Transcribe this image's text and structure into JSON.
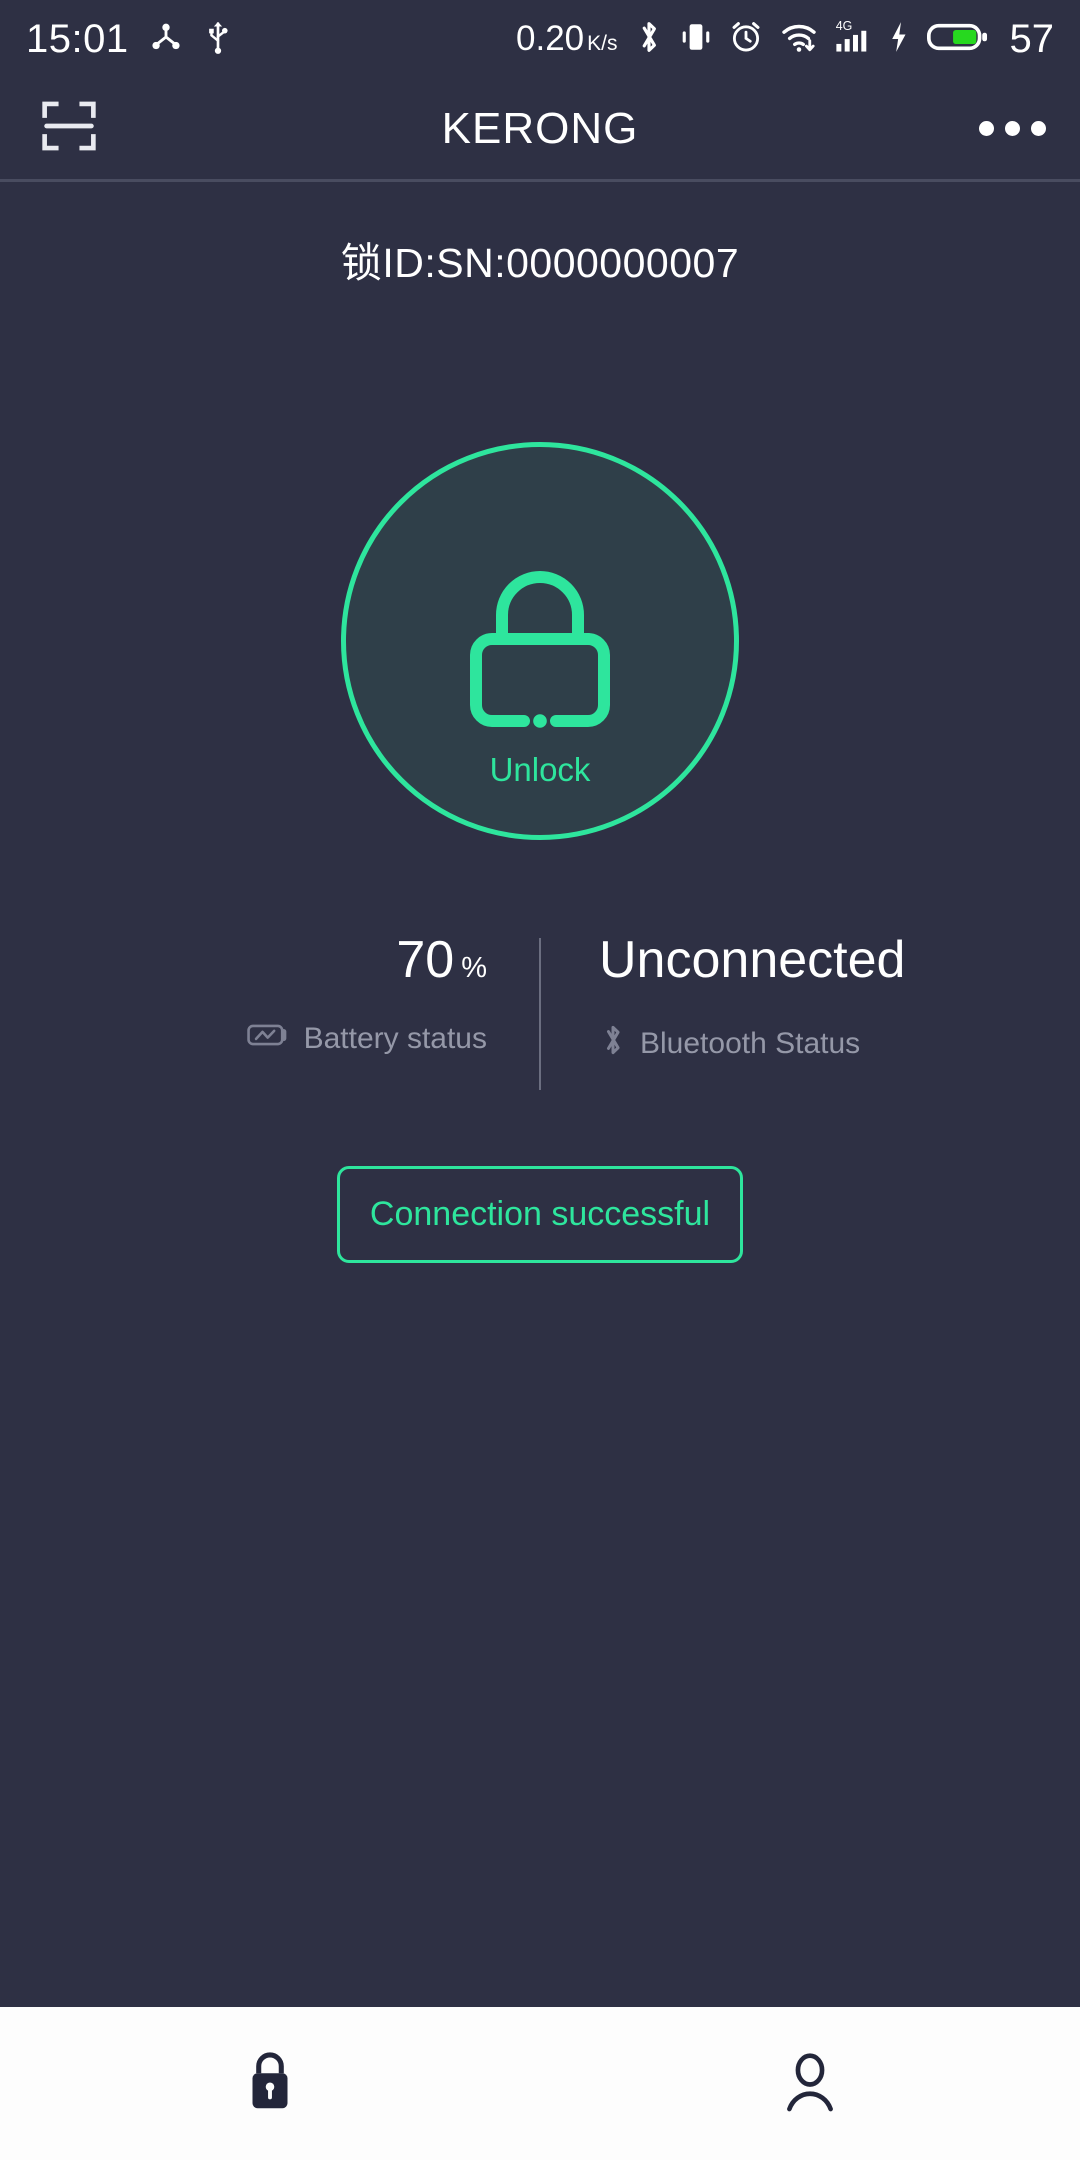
{
  "status_bar": {
    "time": "15:01",
    "network_speed": "0.20",
    "network_speed_unit": "K/s",
    "battery_percent": "57",
    "icons": [
      "share-nodes-icon",
      "usb-icon",
      "bluetooth-icon",
      "vibrate-icon",
      "alarm-clock-icon",
      "wifi-icon",
      "signal-4g-icon",
      "charging-bolt-icon",
      "battery-icon"
    ],
    "signal_label": "4G"
  },
  "app_bar": {
    "title": "KERONG",
    "scan_icon": "scan-qr-icon",
    "overflow_icon": "more-horizontal-icon"
  },
  "main": {
    "lock_id": "锁ID:SN:0000000007",
    "lock_button": {
      "label": "Unlock",
      "icon": "padlock-outline-icon"
    },
    "battery": {
      "value": "70",
      "unit": "%",
      "label": "Battery status",
      "icon": "battery-status-icon"
    },
    "bluetooth": {
      "value": "Unconnected",
      "label": "Bluetooth Status",
      "icon": "bluetooth-icon"
    },
    "connection_button": {
      "label": "Connection successful"
    }
  },
  "bottom_nav": {
    "items": [
      {
        "name": "lock",
        "icon": "padlock-filled-icon",
        "active": true
      },
      {
        "name": "profile",
        "icon": "person-outline-icon",
        "active": false
      }
    ]
  },
  "colors": {
    "background": "#2e3044",
    "accent_green": "#2ee59d",
    "circle_fill": "#2f3f49",
    "muted_text": "#9598a8",
    "nav_background": "#fdfdfd",
    "nav_icon": "#23263a",
    "battery_fill": "#27d81f"
  }
}
